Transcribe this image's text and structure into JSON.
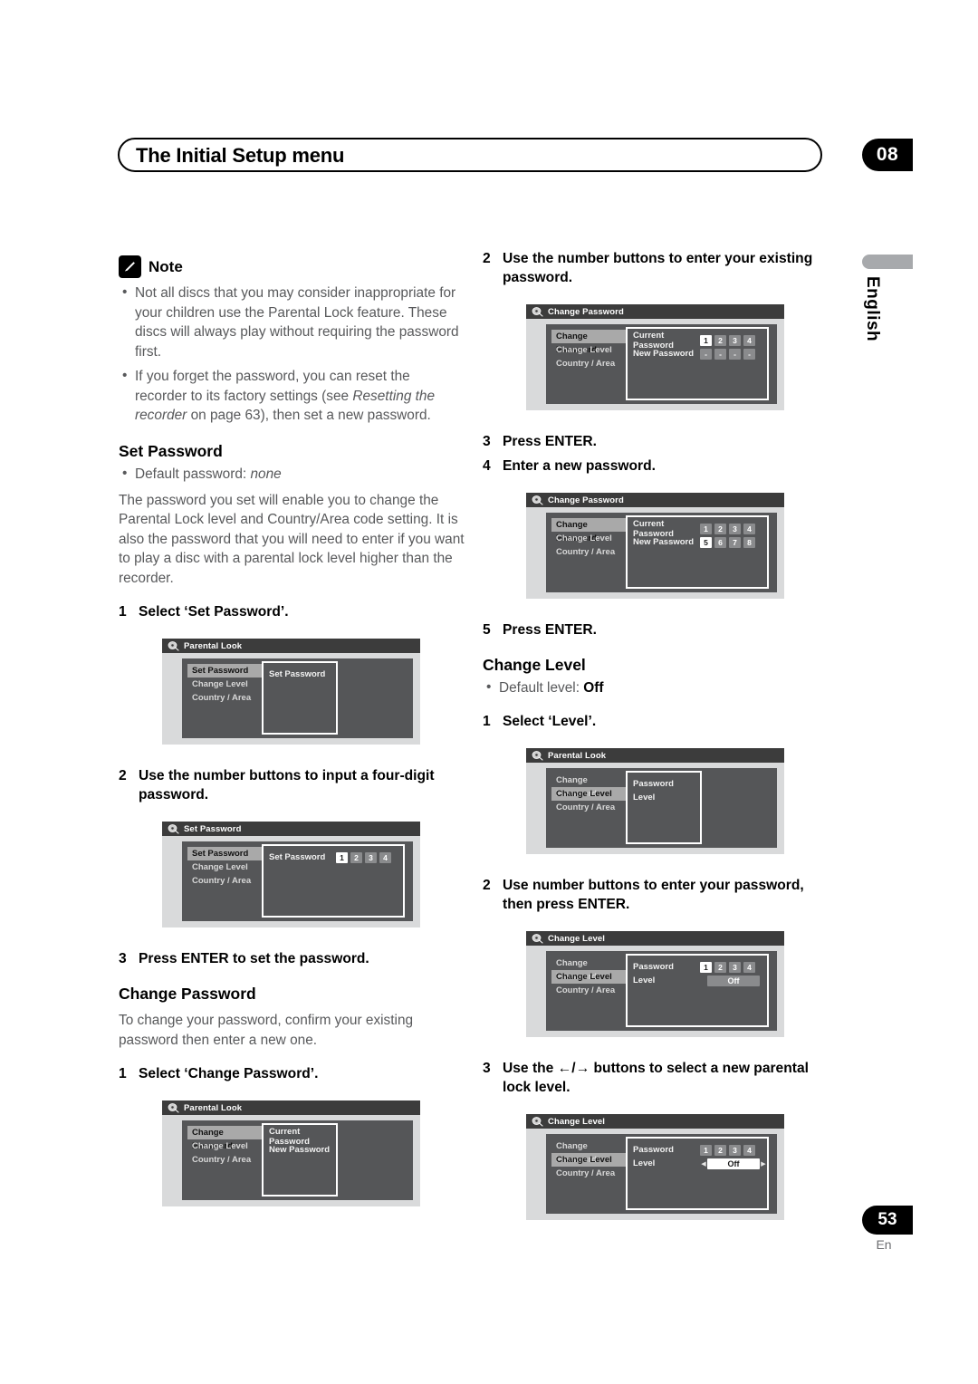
{
  "header": {
    "title": "The Initial Setup menu",
    "chapter": "08"
  },
  "margin": {
    "language_tab": "English"
  },
  "footer": {
    "page_number": "53",
    "page_lang": "En"
  },
  "left_column": {
    "note": {
      "label": "Note",
      "icon": "pencil-note-icon",
      "bullets": [
        "Not all discs that you may consider inappropriate for your children use the Parental Lock feature. These discs will always play without requiring the password first.",
        "If you forget the password, you can reset the recorder to its factory settings (see Resetting the recorder on page 63), then set a new password."
      ],
      "bullet2_pre": "If you forget the password, you can reset the recorder to its factory settings (see ",
      "bullet2_italic": "Resetting the recorder",
      "bullet2_post": " on page 63), then set a new password."
    },
    "set_password": {
      "heading": "Set Password",
      "default_prefix": "Default password: ",
      "default_value": "none",
      "paragraph": "The password you set will enable you to change the Parental Lock level and Country/Area code setting. It is also the password that you will need to enter if you want to play a disc with a parental lock level higher than the recorder.",
      "step1_num": "1",
      "step1_text": "Select ‘Set Password’.",
      "step2_num": "2",
      "step2_text": "Use the number buttons to input a four-digit password.",
      "step3_num": "3",
      "step3_text": "Press ENTER to set the password."
    },
    "change_password": {
      "heading": "Change Password",
      "paragraph": "To change your password, confirm your existing password then enter a new one.",
      "step1_num": "1",
      "step1_text": "Select ‘Change Password’."
    },
    "figures": [
      {
        "id": "fig-set-password-select",
        "title": "Parental Look",
        "menu": [
          {
            "label": "Set Password",
            "selected": true
          },
          {
            "label": "Change Level",
            "selected": false
          },
          {
            "label": "Country / Area",
            "selected": false
          }
        ],
        "rows": [
          {
            "label": "Set Password",
            "control": "none"
          }
        ]
      },
      {
        "id": "fig-set-password-digits",
        "title": "Set Password",
        "menu": [
          {
            "label": "Set Password",
            "selected": true
          },
          {
            "label": "Change Level",
            "selected": false
          },
          {
            "label": "Country / Area",
            "selected": false
          }
        ],
        "rows": [
          {
            "label": "Set Password",
            "control": "digits",
            "digits": [
              "1",
              "2",
              "3",
              "4"
            ],
            "active_index": 0
          }
        ]
      },
      {
        "id": "fig-change-password-select",
        "title": "Parental Look",
        "menu": [
          {
            "label": "Change Password",
            "selected": true
          },
          {
            "label": "Change Level",
            "selected": false
          },
          {
            "label": "Country / Area",
            "selected": false
          }
        ],
        "rows": [
          {
            "label": "Current Password",
            "control": "none"
          },
          {
            "label": "New Password",
            "control": "none"
          }
        ]
      }
    ]
  },
  "right_column": {
    "change_password_steps": {
      "step2_num": "2",
      "step2_text": "Use the number buttons to enter your existing password.",
      "step3_num": "3",
      "step3_text": "Press ENTER.",
      "step4_num": "4",
      "step4_text": "Enter a new password.",
      "step5_num": "5",
      "step5_text": "Press ENTER."
    },
    "change_level": {
      "heading": "Change Level",
      "default_prefix": "Default level: ",
      "default_value": "Off",
      "step1_num": "1",
      "step1_text": "Select ‘Level’.",
      "step2_num": "2",
      "step2_text": "Use number buttons to enter your password, then press ENTER.",
      "step3_num": "3",
      "step3_pre": "Use the ",
      "step3_arrows": "←/→",
      "step3_post": " buttons to select a new parental lock level."
    },
    "figures": [
      {
        "id": "fig-change-password-current",
        "title": "Change Password",
        "menu": [
          {
            "label": "Change Password",
            "selected": true
          },
          {
            "label": "Change Level",
            "selected": false
          },
          {
            "label": "Country / Area",
            "selected": false
          }
        ],
        "rows": [
          {
            "label": "Current Password",
            "control": "digits",
            "digits": [
              "1",
              "2",
              "3",
              "4"
            ],
            "active_index": 0
          },
          {
            "label": "New Password",
            "control": "digits",
            "digits": [
              "-",
              "-",
              "-",
              "-"
            ],
            "active_index": -1
          }
        ]
      },
      {
        "id": "fig-change-password-new",
        "title": "Change Password",
        "menu": [
          {
            "label": "Change Password",
            "selected": true
          },
          {
            "label": "Change Level",
            "selected": false
          },
          {
            "label": "Country / Area",
            "selected": false
          }
        ],
        "rows": [
          {
            "label": "Current Password",
            "control": "digits",
            "digits": [
              "1",
              "2",
              "3",
              "4"
            ],
            "active_index": -1
          },
          {
            "label": "New Password",
            "control": "digits",
            "digits": [
              "5",
              "6",
              "7",
              "8"
            ],
            "active_index": 0
          }
        ]
      },
      {
        "id": "fig-change-level-select",
        "title": "Parental Look",
        "menu": [
          {
            "label": "Change Password",
            "selected": false
          },
          {
            "label": "Change Level",
            "selected": true
          },
          {
            "label": "Country / Area",
            "selected": false
          }
        ],
        "rows": [
          {
            "label": "Password",
            "control": "none"
          },
          {
            "label": "Level",
            "control": "none"
          }
        ]
      },
      {
        "id": "fig-change-level-password",
        "title": "Change Level",
        "menu": [
          {
            "label": "Change Password",
            "selected": false
          },
          {
            "label": "Change Level",
            "selected": true
          },
          {
            "label": "Country / Area",
            "selected": false
          }
        ],
        "rows": [
          {
            "label": "Password",
            "control": "digits",
            "digits": [
              "1",
              "2",
              "3",
              "4"
            ],
            "active_index": 0
          },
          {
            "label": "Level",
            "control": "value",
            "value": "Off",
            "value_active": false,
            "arrows": false
          }
        ]
      },
      {
        "id": "fig-change-level-value",
        "title": "Change Level",
        "menu": [
          {
            "label": "Change Password",
            "selected": false
          },
          {
            "label": "Change Level",
            "selected": true
          },
          {
            "label": "Country / Area",
            "selected": false
          }
        ],
        "rows": [
          {
            "label": "Password",
            "control": "digits",
            "digits": [
              "1",
              "2",
              "3",
              "4"
            ],
            "active_index": -1
          },
          {
            "label": "Level",
            "control": "value",
            "value": "Off",
            "value_active": true,
            "arrows": true
          }
        ]
      }
    ]
  },
  "colors": {
    "ink": "#231f20",
    "body_text": "#58595b",
    "osd_titlebar": "#3c3c3c",
    "osd_body": "#555658",
    "osd_frame": "#d9dadb",
    "osd_selected": "#a9a9a9",
    "osd_digit": "#8a8b8d",
    "accent_black": "#000000"
  }
}
